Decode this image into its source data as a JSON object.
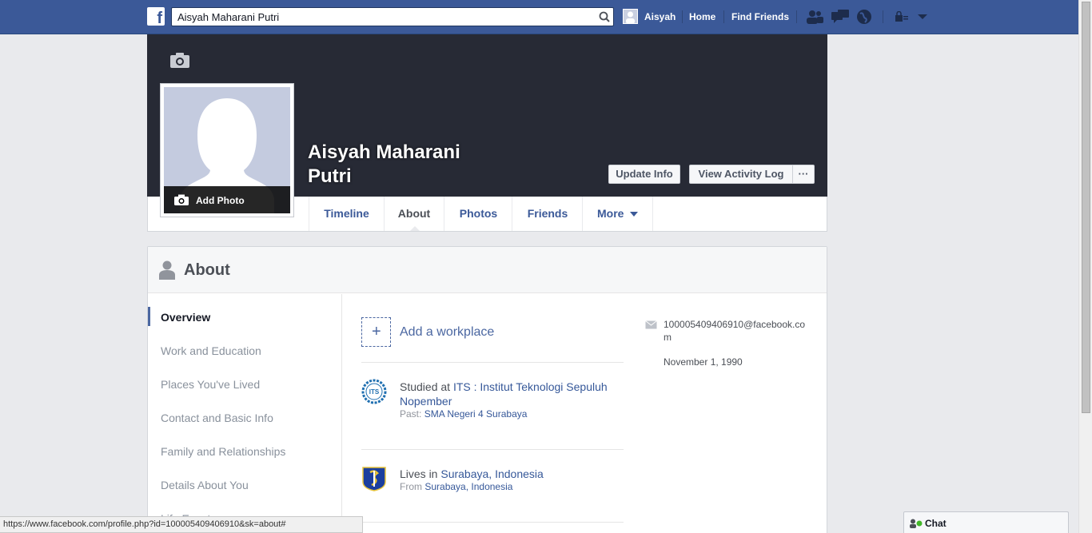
{
  "topbar": {
    "search_value": "Aisyah Maharani Putri",
    "user_name": "Aisyah",
    "home": "Home",
    "find_friends": "Find Friends"
  },
  "profile": {
    "name": "Aisyah Maharani Putri",
    "add_photo": "Add Photo",
    "update_info": "Update Info",
    "view_activity_log": "View Activity Log",
    "more_options": "···"
  },
  "tabs": [
    {
      "label": "Timeline"
    },
    {
      "label": "About"
    },
    {
      "label": "Photos"
    },
    {
      "label": "Friends"
    },
    {
      "label": "More"
    }
  ],
  "about": {
    "title": "About",
    "nav": [
      {
        "label": "Overview"
      },
      {
        "label": "Work and Education"
      },
      {
        "label": "Places You've Lived"
      },
      {
        "label": "Contact and Basic Info"
      },
      {
        "label": "Family and Relationships"
      },
      {
        "label": "Details About You"
      },
      {
        "label": "Life Events"
      }
    ],
    "add_workplace": "Add a workplace",
    "education": {
      "prefix": "Studied at ",
      "school": "ITS : Institut Teknologi Sepuluh Nopember",
      "past_prefix": "Past: ",
      "past_school": "SMA Negeri 4 Surabaya"
    },
    "lives": {
      "prefix": "Lives in ",
      "city": "Surabaya, Indonesia",
      "from_prefix": "From ",
      "from_city": "Surabaya, Indonesia"
    },
    "email": "100005409406910@facebook.com",
    "birthday": "November 1, 1990"
  },
  "status_url": "https://www.facebook.com/profile.php?id=100005409406910&sk=about#",
  "chat": {
    "label": "Chat"
  },
  "colors": {
    "brand": "#3b5998",
    "cover": "#272a35",
    "link": "#365899"
  }
}
